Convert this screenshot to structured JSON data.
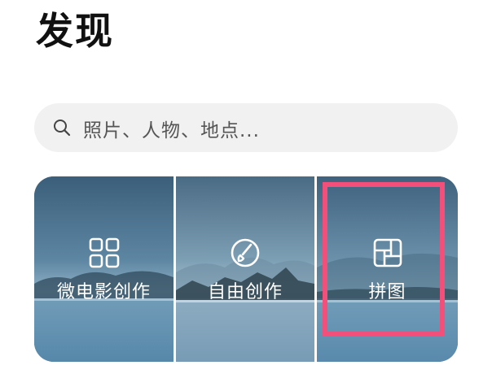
{
  "header": {
    "title": "发现"
  },
  "search": {
    "placeholder": "照片、人物、地点..."
  },
  "cards": [
    {
      "label": "微电影创作",
      "icon": "grid-icon"
    },
    {
      "label": "自由创作",
      "icon": "brush-icon"
    },
    {
      "label": "拼图",
      "icon": "collage-icon"
    }
  ],
  "colors": {
    "highlight": "#f2507a",
    "search_bg": "#f1f1f1"
  }
}
